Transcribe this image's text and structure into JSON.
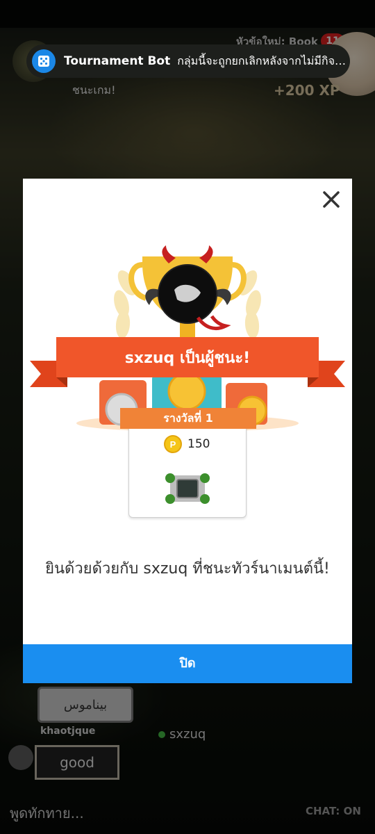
{
  "background": {
    "topic_text": "หัวข้อใหม่: Book",
    "badge_count": "11",
    "win_text": "ชนะเกม!",
    "xp_text": "+200 XP",
    "chat": {
      "arabic_message": "بيناموس",
      "username_1": "khaotjque",
      "username_2": "sxzuq",
      "good_message": "good",
      "input_placeholder": "พูดทักทาย...",
      "status": "CHAT: ON"
    }
  },
  "toast": {
    "icon": "dice-icon",
    "title": "Tournament Bot",
    "message": "กลุ่มนี้จะถูกยกเลิกหลังจากไม่มีกิจกรรม"
  },
  "modal": {
    "close_icon": "close-icon",
    "winner_banner": "sxzuq เป็นผู้ชนะ!",
    "reward_label": "รางวัลที่ 1",
    "reward_coins": "150",
    "coin_icon": "p-coin-icon",
    "congrats": "ยินด้วยด้วยกับ sxzuq ที่ชนะทัวร์นาเมนต์นี้!",
    "close_button": "ปิด",
    "colors": {
      "banner": "#f0562a",
      "ribbon": "#f08337",
      "button": "#1a8ef0"
    }
  }
}
